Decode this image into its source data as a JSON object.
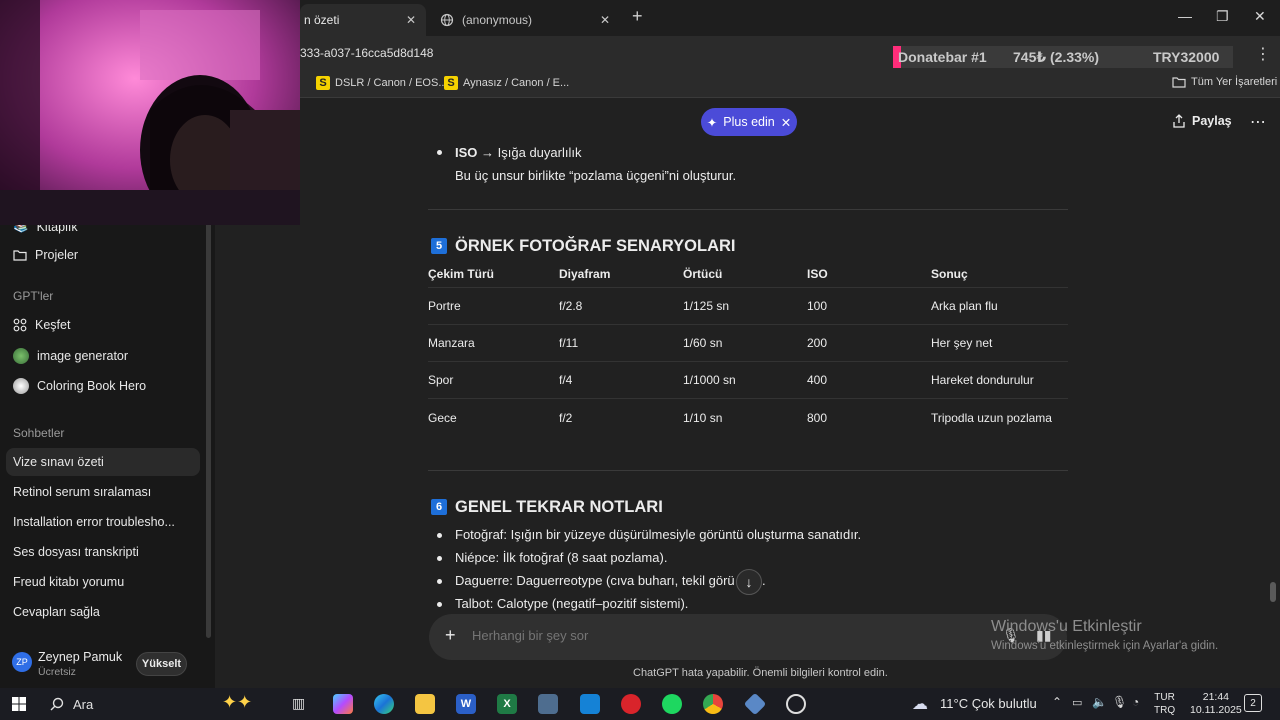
{
  "browser": {
    "active_tab_title": "n özeti",
    "second_tab_title": "(anonymous)",
    "url_fragment": "333-a037-16cca5d8d148",
    "bookmarks": [
      {
        "icon": "S",
        "label": "DSLR / Canon / EOS..."
      },
      {
        "icon": "S",
        "label": "Aynasız / Canon / E..."
      }
    ],
    "all_bookmarks_label": "Tüm Yer İşaretleri"
  },
  "donatebar": {
    "name": "Donatebar #1",
    "amount": "745₺ (2.33%)",
    "goal": "TRY32000",
    "progress": 0.0233,
    "color": "#ff2d7a"
  },
  "sidebar": {
    "library_label": "Kitaplık",
    "projects_label": "Projeler",
    "gpts_heading": "GPT'ler",
    "gpts": [
      {
        "icon": "explore-icon",
        "label": "Keşfet"
      },
      {
        "icon": "image-generator-avatar",
        "label": "image generator"
      },
      {
        "icon": "coloring-book-avatar",
        "label": "Coloring Book Hero"
      }
    ],
    "chats_heading": "Sohbetler",
    "chats": [
      "Vize sınavı özeti",
      "Retinol serum sıralaması",
      "Installation error troublesho...",
      "Ses dosyası transkripti",
      "Freud kitabı yorumu",
      "Cevapları sağla"
    ],
    "user": {
      "initials": "ZP",
      "name": "Zeynep Pamuk",
      "plan": "Ücretsiz",
      "upgrade_label": "Yükselt"
    }
  },
  "header": {
    "plus_label": "Plus edin",
    "share_label": "Paylaş"
  },
  "content": {
    "iso_bold": "ISO",
    "iso_rest": "→ Işığa duyarlılık",
    "iso_note": "Bu üç unsur birlikte “pozlama üçgeni”ni oluşturur.",
    "section5": {
      "number": "5",
      "title": "ÖRNEK FOTOĞRAF SENARYOLARI",
      "headers": [
        "Çekim Türü",
        "Diyafram",
        "Örtücü",
        "ISO",
        "Sonuç"
      ],
      "rows": [
        [
          "Portre",
          "f/2.8",
          "1/125 sn",
          "100",
          "Arka plan flu"
        ],
        [
          "Manzara",
          "f/11",
          "1/60 sn",
          "200",
          "Her şey net"
        ],
        [
          "Spor",
          "f/4",
          "1/1000 sn",
          "400",
          "Hareket dondurulur"
        ],
        [
          "Gece",
          "f/2",
          "1/10 sn",
          "800",
          "Tripodla uzun pozlama"
        ]
      ]
    },
    "section6": {
      "number": "6",
      "title": "GENEL TEKRAR NOTLARI",
      "bullets": [
        "Fotoğraf: Işığın bir yüzeye düşürülmesiyle görüntü oluşturma sanatıdır.",
        "Niépce: İlk fotoğraf (8 saat pozlama).",
        "Daguerre: Daguerreotype (cıva buharı, tekil görü",
        "Talbot: Calotype (negatif–pozitif sistemi)."
      ],
      "bullet3_tail": "."
    }
  },
  "composer": {
    "placeholder": "Herhangi bir şey sor",
    "disclaimer": "ChatGPT hata yapabilir. Önemli bilgileri kontrol edin."
  },
  "watermark": {
    "line1": "Windows'u Etkinleştir",
    "line2": "Windows'u etkinleştirmek için Ayarlar'a gidin."
  },
  "taskbar": {
    "search_label": "Ara",
    "weather": "11°C  Çok bulutlu",
    "lang_top": "TUR",
    "lang_bottom": "TRQ",
    "time": "21:44",
    "date": "10.11.2025",
    "notification_count": "2"
  }
}
